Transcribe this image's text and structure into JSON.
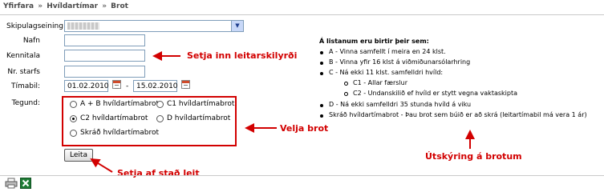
{
  "breadcrumb": {
    "items": [
      "Yfirfara",
      "Hvíldartímar",
      "Brot"
    ],
    "separator": "»"
  },
  "form": {
    "unit_label": "Skipulagseining",
    "name_label": "Nafn",
    "kennitala_label": "Kennitala",
    "nr_label": "Nr. starfs",
    "period_label": "Tímabil:",
    "date_from": "01.02.2010",
    "date_sep": "-",
    "date_to": "15.02.2010",
    "type_label": "Tegund:",
    "search_button": "Leita"
  },
  "types": [
    {
      "label": "A + B hvíldartímabrot",
      "selected": false
    },
    {
      "label": "C1 hvíldartímabrot",
      "selected": false
    },
    {
      "label": "C2 hvíldartímabrot",
      "selected": true
    },
    {
      "label": "D hvíldartímabrot",
      "selected": false
    },
    {
      "label": "Skráð hvíldartímabrot",
      "selected": false
    }
  ],
  "annotations": {
    "search_criteria": "Setja inn leitarskilyrði",
    "choose_violation": "Velja brot",
    "start_search": "Setja af stað leit",
    "explanation": "Útskýring á brotum"
  },
  "info": {
    "title": "Á listanum eru birtir þeir sem:",
    "line_a": "A - Vinna samfellt í meira en 24 klst.",
    "line_b": "B - Vinna yfir 16 klst á viðmiðunarsólarhring",
    "line_c": "C - Ná ekki 11 klst. samfelldri hvíld:",
    "line_c1": "C1 - Allar færslur",
    "line_c2": "C2 - Undanskilið ef hvíld er stytt vegna vaktaskipta",
    "line_d": "D - Ná ekki samfelldri 35 stunda hvíld á viku",
    "line_s": "Skráð hvíldartímabrot - Þau brot sem búið er að skrá (leitartímabil má vera 1 ár)"
  },
  "colors": {
    "annotation": "#d20000",
    "frame_border": "#c9c9c9"
  },
  "icons": [
    "calendar-icon",
    "printer-icon",
    "excel-icon"
  ]
}
